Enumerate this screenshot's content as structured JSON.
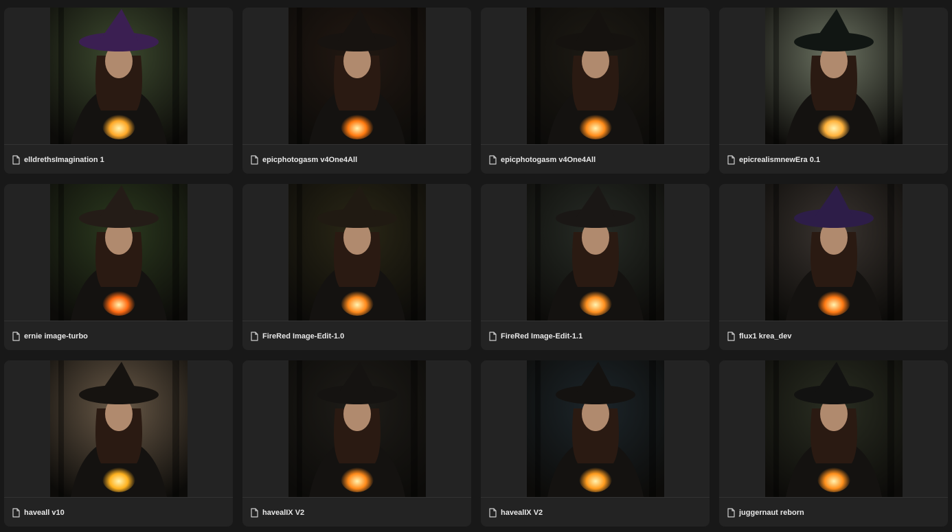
{
  "colors": {
    "page_background": "#181818",
    "card_background": "#232323",
    "caption_text": "#e8e8e8"
  },
  "cards": [
    {
      "title": "elldrethsImagination 1",
      "icon": "file-icon",
      "image": "witch-portrait-purple-hat",
      "palette": {
        "bg": "#3d4a2f",
        "hat": "#3b1f52",
        "fire": "#ffa928"
      }
    },
    {
      "title": "epicphotogasm v4One4All",
      "icon": "file-icon",
      "image": "witch-portrait-black-hat-flames",
      "palette": {
        "bg": "#221812",
        "hat": "#171310",
        "fire": "#ff7a10"
      }
    },
    {
      "title": "epicphotogasm v4One4All",
      "icon": "file-icon",
      "image": "witch-portrait-girl-dark-forest",
      "palette": {
        "bg": "#1d1a14",
        "hat": "#15120f",
        "fire": "#ff8c1a"
      }
    },
    {
      "title": "epicrealismnewEra 0.1",
      "icon": "file-icon",
      "image": "witch-portrait-candle",
      "palette": {
        "bg": "#6c7362",
        "hat": "#111613",
        "fire": "#ffb23c"
      }
    },
    {
      "title": "ernie image-turbo",
      "icon": "file-icon",
      "image": "witch-portrait-fire-arcs-cabins",
      "palette": {
        "bg": "#2c3a1f",
        "hat": "#241c17",
        "fire": "#ff6a12"
      }
    },
    {
      "title": "FireRed Image-Edit-1.0",
      "icon": "file-icon",
      "image": "witch-portrait-brown-robe",
      "palette": {
        "bg": "#2a2716",
        "hat": "#201a12",
        "fire": "#ff8a1c"
      }
    },
    {
      "title": "FireRed Image-Edit-1.1",
      "icon": "file-icon",
      "image": "witch-portrait-village-night",
      "palette": {
        "bg": "#272c26",
        "hat": "#1a1715",
        "fire": "#ff9020"
      }
    },
    {
      "title": "flux1 krea_dev",
      "icon": "file-icon",
      "image": "witch-portrait-green-face",
      "palette": {
        "bg": "#3a3430",
        "hat": "#2d1d48",
        "fire": "#ff7a14"
      }
    },
    {
      "title": "haveall v10",
      "icon": "file-icon",
      "image": "witch-portrait-golden-glow",
      "palette": {
        "bg": "#6a5a48",
        "hat": "#161310",
        "fire": "#ffb21f"
      }
    },
    {
      "title": "havealIX V2",
      "icon": "file-icon",
      "image": "witch-portrait-pale-face",
      "palette": {
        "bg": "#1e1c18",
        "hat": "#151311",
        "fire": "#ff8a1a"
      }
    },
    {
      "title": "havealIX V2",
      "icon": "file-icon",
      "image": "witch-portrait-yellow-face-cauldron",
      "palette": {
        "bg": "#1c252a",
        "hat": "#141210",
        "fire": "#ff9c1e"
      }
    },
    {
      "title": "juggernaut reborn",
      "icon": "file-icon",
      "image": "witch-portrait-forest-torches",
      "palette": {
        "bg": "#2a2e22",
        "hat": "#121211",
        "fire": "#ff901c"
      }
    }
  ]
}
